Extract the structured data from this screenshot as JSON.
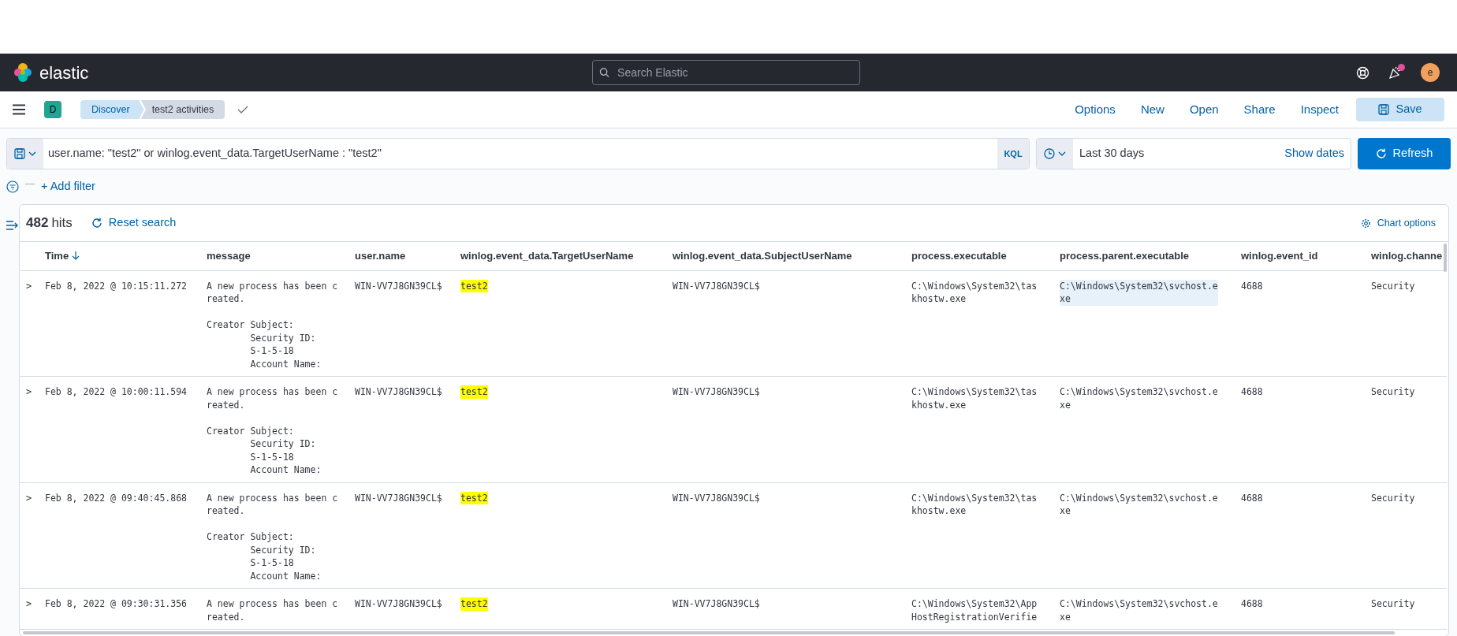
{
  "header": {
    "logo_text": "elastic",
    "search_placeholder": "Search Elastic",
    "news_unread": true,
    "avatar_initial": "e"
  },
  "toolbar": {
    "space_initial": "D",
    "breadcrumbs": [
      {
        "label": "Discover",
        "current": false
      },
      {
        "label": "test2 activities",
        "current": true
      }
    ],
    "links": [
      "Options",
      "New",
      "Open",
      "Share",
      "Inspect"
    ],
    "save": "Save"
  },
  "query": {
    "value": "user.name: \"test2\" or winlog.event_data.TargetUserName : \"test2\"",
    "language": "KQL",
    "date_range": "Last 30 days",
    "show_dates": "Show dates",
    "refresh": "Refresh"
  },
  "filters": {
    "separator": "—",
    "add": "+ Add filter"
  },
  "results": {
    "hits": "482",
    "hits_label": "hits",
    "reset": "Reset search",
    "chart_options": "Chart options"
  },
  "table": {
    "columns": [
      {
        "label": "Time",
        "kind": "time",
        "sorted": true
      },
      {
        "label": "message",
        "kind": "text",
        "sorted": false
      },
      {
        "label": "user.name",
        "kind": "text",
        "sorted": false
      },
      {
        "label": "winlog.event_data.TargetUserName",
        "kind": "match",
        "sorted": false
      },
      {
        "label": "winlog.event_data.SubjectUserName",
        "kind": "text",
        "sorted": false
      },
      {
        "label": "process.executable",
        "kind": "text",
        "sorted": false
      },
      {
        "label": "process.parent.executable",
        "kind": "text",
        "sorted": false
      },
      {
        "label": "winlog.event_id",
        "kind": "text",
        "sorted": false
      },
      {
        "label": "winlog.channe",
        "kind": "text",
        "sorted": false
      }
    ],
    "rows": [
      {
        "expand": ">",
        "parent_highlighted": true,
        "cells": [
          "Feb 8, 2022 @ 10:15:11.272",
          "A new process has been c\nreated.\n\nCreator Subject:\n        Security ID:\n        S-1-5-18\n        Account Name:",
          "WIN-VV7J8GN39CL$",
          "test2",
          "WIN-VV7J8GN39CL$",
          "C:\\Windows\\System32\\tas\nkhostw.exe",
          "C:\\Windows\\System32\\svchost.e\nxe",
          "4688",
          "Security"
        ]
      },
      {
        "expand": ">",
        "parent_highlighted": false,
        "cells": [
          "Feb 8, 2022 @ 10:00:11.594",
          "A new process has been c\nreated.\n\nCreator Subject:\n        Security ID:\n        S-1-5-18\n        Account Name:",
          "WIN-VV7J8GN39CL$",
          "test2",
          "WIN-VV7J8GN39CL$",
          "C:\\Windows\\System32\\tas\nkhostw.exe",
          "C:\\Windows\\System32\\svchost.e\nxe",
          "4688",
          "Security"
        ]
      },
      {
        "expand": ">",
        "parent_highlighted": false,
        "cells": [
          "Feb 8, 2022 @ 09:40:45.868",
          "A new process has been c\nreated.\n\nCreator Subject:\n        Security ID:\n        S-1-5-18\n        Account Name:",
          "WIN-VV7J8GN39CL$",
          "test2",
          "WIN-VV7J8GN39CL$",
          "C:\\Windows\\System32\\tas\nkhostw.exe",
          "C:\\Windows\\System32\\svchost.e\nxe",
          "4688",
          "Security"
        ]
      },
      {
        "expand": ">",
        "parent_highlighted": false,
        "cells": [
          "Feb 8, 2022 @ 09:30:31.356",
          "A new process has been c\nreated.",
          "WIN-VV7J8GN39CL$",
          "test2",
          "WIN-VV7J8GN39CL$",
          "C:\\Windows\\System32\\App\nHostRegistrationVerifie",
          "C:\\Windows\\System32\\svchost.e\nxe",
          "4688",
          "Security"
        ]
      }
    ]
  }
}
